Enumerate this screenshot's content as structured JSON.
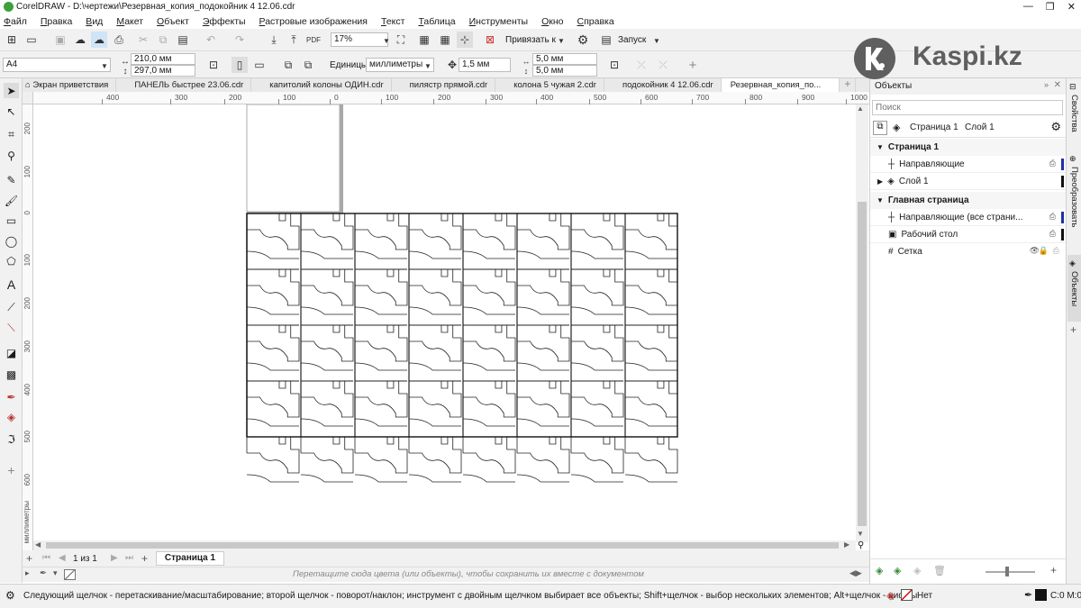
{
  "window": {
    "title": "CorelDRAW - D:\\чертежи\\Резервная_копия_подокойник 4 12.06.cdr",
    "controls": [
      "—",
      "❐",
      "✕"
    ]
  },
  "menu": [
    "Файл",
    "Правка",
    "Вид",
    "Макет",
    "Объект",
    "Эффекты",
    "Растровые изображения",
    "Текст",
    "Таблица",
    "Инструменты",
    "Окно",
    "Справка"
  ],
  "toolbar1": {
    "zoom": "17%",
    "snap_label": "Привязать к",
    "launch_label": "Запуск"
  },
  "toolbar2": {
    "page_size": "A4",
    "width": "210,0 мм",
    "height": "297,0 мм",
    "units_label": "Единицы:",
    "units_value": "миллиметры",
    "nudge": "1,5 мм",
    "dup_x": "5,0 мм",
    "dup_y": "5,0 мм"
  },
  "tabs": [
    {
      "label": "Экран приветствия",
      "active": false
    },
    {
      "label": "ПАНЕЛЬ быстрее 23.06.cdr",
      "active": false
    },
    {
      "label": "капитолий колоны ОДИН.cdr",
      "active": false
    },
    {
      "label": "пилястр прямой.cdr",
      "active": false
    },
    {
      "label": "колона 5 чужая 2.cdr",
      "active": false
    },
    {
      "label": "подокойник 4 12.06.cdr",
      "active": false
    },
    {
      "label": "Резервная_копия_по...",
      "active": true
    }
  ],
  "hruler_ticks": [
    "400",
    "300",
    "200",
    "100",
    "0",
    "100",
    "200",
    "300",
    "400",
    "500",
    "600",
    "700",
    "800",
    "900",
    "1000",
    "1100",
    "1200"
  ],
  "vruler_ticks": [
    "200",
    "100",
    "0",
    "100",
    "200",
    "300",
    "400",
    "500",
    "600"
  ],
  "vruler_unit": "миллиметры",
  "pagebar": {
    "page_count": "1 из 1",
    "page_tab": "Страница 1"
  },
  "palette_hint": "Перетащите сюда цвета (или объекты), чтобы сохранить их вместе с документом",
  "status": {
    "hint": "Следующий щелчок - перетаскивание/масштабирование; второй щелчок - поворот/наклон; инструмент с двойным щелчком выбирает все объекты; Shift+щелчок - выбор нескольких элементов; Alt+щелчок - цифры",
    "fill": "Нет",
    "outline": "C:0 M:0"
  },
  "dock": {
    "title": "Объекты",
    "search_placeholder": "Поиск",
    "page_label": "Страница 1",
    "layer_label": "Слой 1",
    "tree": [
      {
        "label": "Страница 1",
        "level": 0,
        "header": true
      },
      {
        "label": "Направляющие",
        "level": 1,
        "header": false,
        "color": "#1f2fa8"
      },
      {
        "label": "Слой 1",
        "level": 1,
        "header": false,
        "color": "#111111"
      },
      {
        "label": "Главная страница",
        "level": 0,
        "header": true
      },
      {
        "label": "Направляющие (все страни...",
        "level": 1,
        "header": false,
        "color": "#1f2fa8"
      },
      {
        "label": "Рабочий стол",
        "level": 1,
        "header": false,
        "color": "#111111"
      },
      {
        "label": "Сетка",
        "level": 1,
        "header": false,
        "color": ""
      }
    ]
  },
  "side_tabs": [
    "Свойства",
    "Преобразовать",
    "Объекты"
  ],
  "watermark": "Kaspi.kz",
  "grid": {
    "columns": 8,
    "rows": 5
  }
}
